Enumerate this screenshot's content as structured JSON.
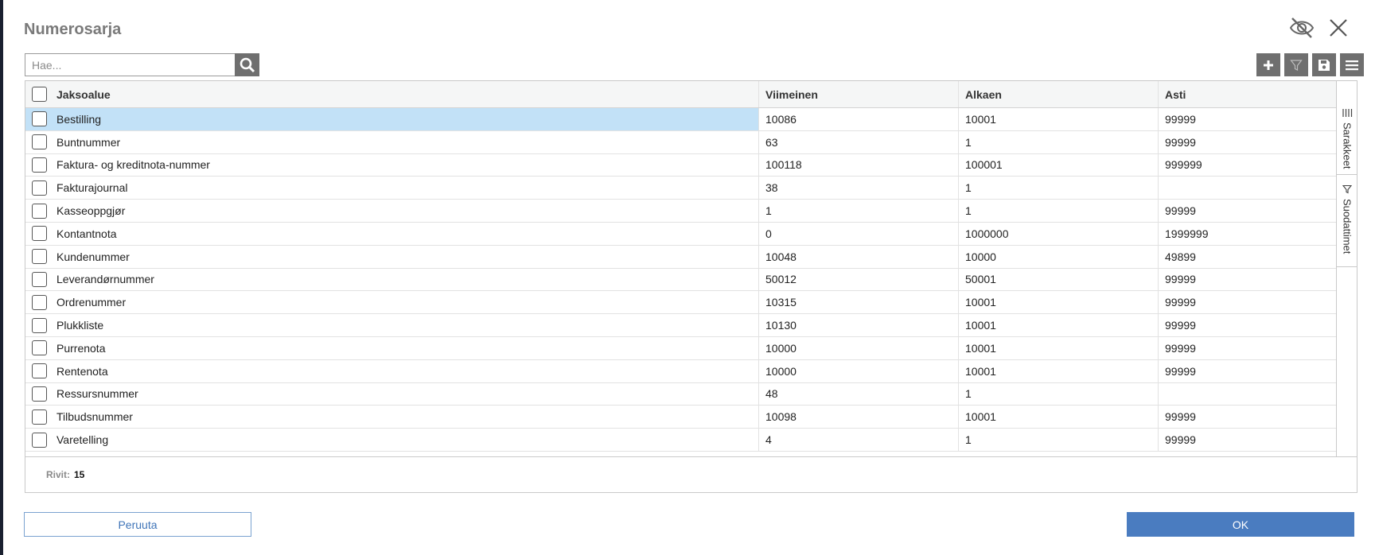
{
  "dialog": {
    "title": "Numerosarja"
  },
  "search": {
    "placeholder": "Hae...",
    "value": ""
  },
  "toolbar": {
    "icons": [
      "plus-icon",
      "filter-icon",
      "save-icon",
      "menu-icon"
    ]
  },
  "grid": {
    "columns": {
      "name": "Jaksoalue",
      "last": "Viimeinen",
      "from": "Alkaen",
      "to": "Asti"
    },
    "rows": [
      {
        "name": "Bestilling",
        "last": "10086",
        "from": "10001",
        "to": "99999",
        "selected": true
      },
      {
        "name": "Buntnummer",
        "last": "63",
        "from": "1",
        "to": "99999"
      },
      {
        "name": "Faktura- og kreditnota-nummer",
        "last": "100118",
        "from": "100001",
        "to": "999999"
      },
      {
        "name": "Fakturajournal",
        "last": "38",
        "from": "1",
        "to": ""
      },
      {
        "name": "Kasseoppgjør",
        "last": "1",
        "from": "1",
        "to": "99999"
      },
      {
        "name": "Kontantnota",
        "last": "0",
        "from": "1000000",
        "to": "1999999"
      },
      {
        "name": "Kundenummer",
        "last": "10048",
        "from": "10000",
        "to": "49899"
      },
      {
        "name": "Leverandørnummer",
        "last": "50012",
        "from": "50001",
        "to": "99999"
      },
      {
        "name": "Ordrenummer",
        "last": "10315",
        "from": "10001",
        "to": "99999"
      },
      {
        "name": "Plukkliste",
        "last": "10130",
        "from": "10001",
        "to": "99999"
      },
      {
        "name": "Purrenota",
        "last": "10000",
        "from": "10001",
        "to": "99999"
      },
      {
        "name": "Rentenota",
        "last": "10000",
        "from": "10001",
        "to": "99999"
      },
      {
        "name": "Ressursnummer",
        "last": "48",
        "from": "1",
        "to": ""
      },
      {
        "name": "Tilbudsnummer",
        "last": "10098",
        "from": "10001",
        "to": "99999"
      },
      {
        "name": "Varetelling",
        "last": "4",
        "from": "1",
        "to": "99999"
      }
    ],
    "footer": {
      "rows_label": "Rivit:",
      "rows_count": "15"
    }
  },
  "side_panel": {
    "columns_tab": "Sarakkeet",
    "filters_tab": "Suodattimet"
  },
  "buttons": {
    "cancel": "Peruuta",
    "ok": "OK"
  },
  "colors": {
    "selected_row": "#c2e1f7",
    "toolbar_button": "#6f6f6f",
    "primary": "#4a7cc0"
  }
}
